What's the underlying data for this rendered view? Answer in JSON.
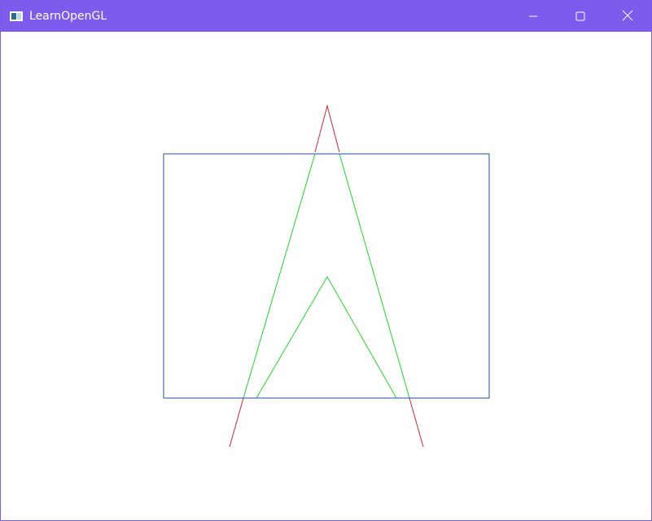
{
  "window": {
    "title": "LearnOpenGL",
    "accent_color": "#7d5bec",
    "icons": {
      "app": "app-window-icon",
      "minimize": "minimize-icon",
      "maximize": "maximize-icon",
      "close": "close-icon"
    }
  },
  "scene": {
    "background": "#ffffff",
    "colors": {
      "rectangle": "#1f4fa6",
      "outer_triangle_clipped": "#d2233a",
      "inner_shape": "#22d62a"
    }
  }
}
